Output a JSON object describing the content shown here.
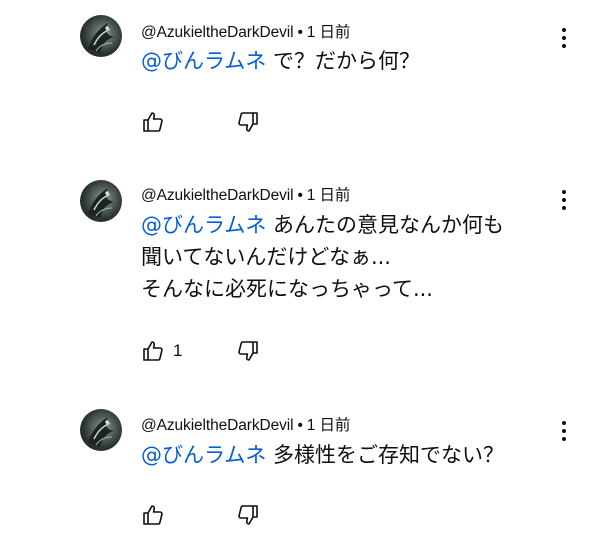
{
  "comments": [
    {
      "author": "@AzukieltheDarkDevil",
      "time": "1 日前",
      "mention": "@びんラムネ",
      "text": " で？だから何？",
      "likes": ""
    },
    {
      "author": "@AzukieltheDarkDevil",
      "time": "1 日前",
      "mention": "@びんラムネ",
      "text": " あんたの意見なんか何も\n聞いてないんだけどなぁ...\nそんなに必死になっちゃって...",
      "likes": "1"
    },
    {
      "author": "@AzukieltheDarkDevil",
      "time": "1 日前",
      "mention": "@びんラムネ",
      "text": " 多様性をご存知でない？",
      "likes": ""
    }
  ],
  "separator": "•",
  "icons": {
    "like": "thumb-up-icon",
    "dislike": "thumb-down-icon",
    "more": "more-vert-icon"
  },
  "colors": {
    "mention": "#065fd4",
    "text": "#0f0f0f"
  }
}
